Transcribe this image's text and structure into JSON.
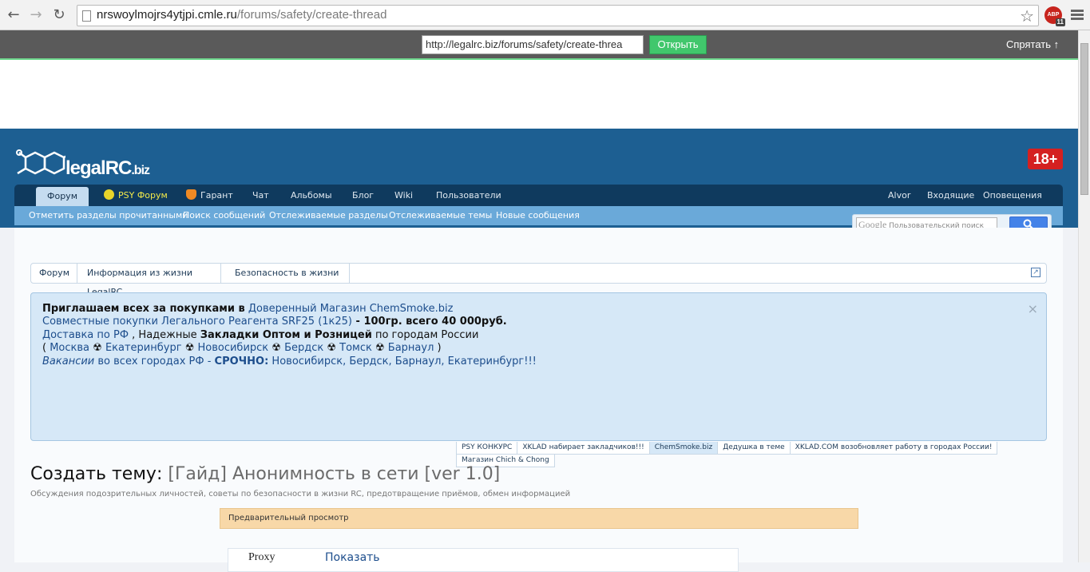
{
  "browser": {
    "url_host": "nrswoylmojrs4ytjpi.cmle.ru",
    "url_path": "/forums/safety/create-thread",
    "abp_label": "ABP",
    "abp_count": "11"
  },
  "mirror_bar": {
    "url_value": "http://legalrc.biz/forums/safety/create-threa",
    "open_label": "Открыть",
    "hide_label": "Спрятать"
  },
  "header": {
    "logo_text": "legalRC",
    "logo_suffix": ".biz",
    "age_badge": "18+"
  },
  "nav": {
    "tabs": [
      "Форум",
      "PSY Форум",
      "Гарант",
      "Чат",
      "Альбомы",
      "Блог",
      "Wiki",
      "Пользователи"
    ],
    "right": [
      "Alvor",
      "Входящие",
      "Оповещения"
    ]
  },
  "subnav": {
    "links": [
      "Отметить разделы прочитанными",
      "Поиск сообщений",
      "Отслеживаемые разделы",
      "Отслеживаемые темы",
      "Новые сообщения"
    ]
  },
  "search": {
    "brand": "Google",
    "placeholder": "Пользовательский поиск"
  },
  "breadcrumb": [
    "Форум",
    "Информация из жизни LegalRC",
    "Безопасность в жизни"
  ],
  "notice": {
    "l1_text": "Приглашаем всех за покупками в",
    "l1_link": "Доверенный Магазин ChemSmoke.biz",
    "l2_link": "Совместные покупки Легального Реагента SRF25 (1к25)",
    "l2_text": " - 100гр. всего 40 000руб.",
    "l3_link": "Доставка по РФ",
    "l3_text1": " , Надежные ",
    "l3_bold1": "Закладки Оптом и Розницей",
    "l3_text2": " по городам России",
    "l4_open": "( ",
    "cities": [
      "Москва",
      "Екатеринбург",
      "Новосибирск",
      "Бердск",
      "Томск",
      "Барнаул"
    ],
    "city_sep": " ☢ ",
    "l4_close": " )",
    "l5_link": "Вакансии",
    "l5_text": " во всех городах РФ - ",
    "l5_bold": "СРОЧНО:",
    "l5_text2": " Новосибирск, Бердск, Барнаул, Екатеринбург!!!",
    "close": "×"
  },
  "notice_tabs": [
    "PSY КОНКУРС",
    "XKLAD набирает закладчиков!!!",
    "ChemSmoke.biz",
    "Дедушка в теме",
    "XKLAD.COM возобновляет работу в городах России!",
    "Магазин Chich & Chong"
  ],
  "page": {
    "title_prefix": "Создать тему:",
    "thread_title": "[Гайд] Анонимность в сети [ver 1.0]",
    "description": "Обсуждения подозрительных личностей, советы по безопасности в жизни RC, предотвращение приёмов, обмен информацией",
    "preview_label": "Предварительный просмотр",
    "spoiler_label": "Proxy",
    "spoiler_show": "Показать"
  }
}
